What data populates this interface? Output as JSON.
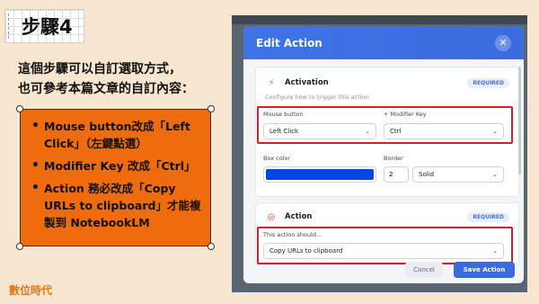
{
  "step_title": "步驟4",
  "intro": {
    "line1": "這個步驟可以自訂選取方式，",
    "line2": "也可參考本篇文章的自訂內容："
  },
  "bullets": [
    "Mouse button改成「Left Click」（左鍵點選）",
    "Modifier Key 改成「Ctrl」",
    "Action 務必改成「Copy URLs to clipboard」才能複製到 NotebookLM"
  ],
  "brand": "數位時代",
  "modal": {
    "title": "Edit Action",
    "close_icon": "close-icon",
    "activation": {
      "icon": "bolt-icon",
      "title": "Activation",
      "badge": "REQUIRED",
      "subtitle": "Configure how to trigger this action",
      "mouse_label": "Mouse button",
      "mouse_value": "Left Click",
      "modifier_label": "+ Modifier Key",
      "modifier_value": "Ctrl",
      "box_color_label": "Box color",
      "box_color": "#0046e0",
      "border_label": "Border",
      "border_width": "2",
      "border_style": "Solid"
    },
    "action": {
      "icon": "target-icon",
      "title": "Action",
      "badge": "REQUIRED",
      "subtitle": "This action should...",
      "value": "Copy URLs to clipboard"
    },
    "cancel_label": "Cancel",
    "save_label": "Save Action"
  },
  "colors": {
    "orange": "#ee6c0e",
    "accent": "#3a6ce0",
    "highlight": "#d81e2a",
    "background": "#f7e6cf"
  }
}
